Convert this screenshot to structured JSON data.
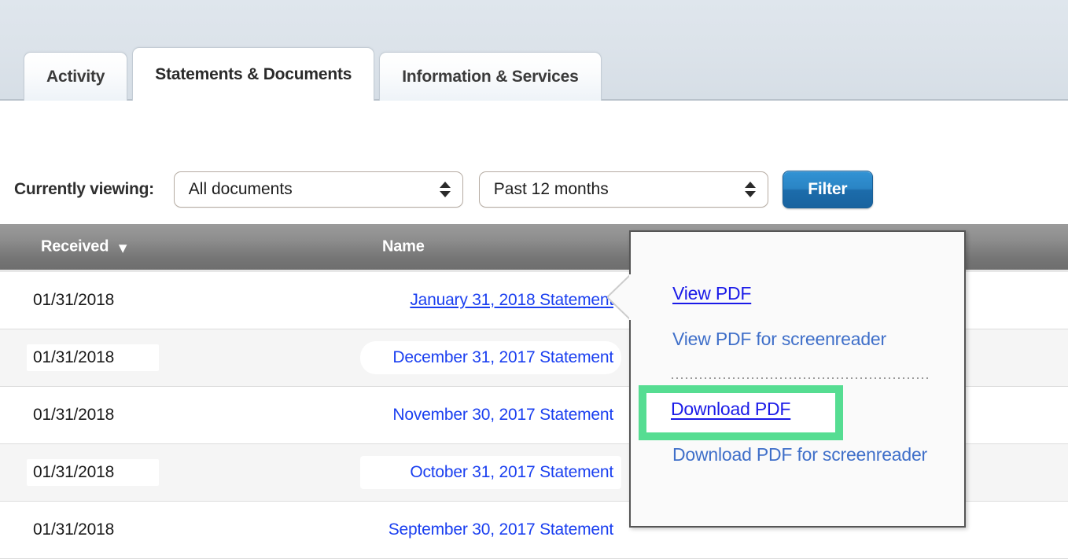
{
  "tabs": [
    {
      "label": "Activity",
      "active": false
    },
    {
      "label": "Statements & Documents",
      "active": true
    },
    {
      "label": "Information & Services",
      "active": false
    }
  ],
  "filter_bar": {
    "viewing_label": "Currently viewing:",
    "document_select": {
      "value": "All documents",
      "icon": "stepper-icon"
    },
    "period_select": {
      "value": "Past 12 months",
      "icon": "stepper-icon"
    },
    "filter_button": "Filter"
  },
  "table": {
    "columns": [
      {
        "key": "received",
        "label": "Received",
        "sort_icon": "▼",
        "sorted": true
      },
      {
        "key": "name",
        "label": "Name"
      }
    ],
    "rows": [
      {
        "received": "01/31/2018",
        "name": "January 31, 2018 Statement"
      },
      {
        "received": "01/31/2018",
        "name": "December 31, 2017 Statement"
      },
      {
        "received": "01/31/2018",
        "name": "November 30, 2017 Statement"
      },
      {
        "received": "01/31/2018",
        "name": "October 31, 2017 Statement"
      },
      {
        "received": "01/31/2018",
        "name": "September 30, 2017 Statement"
      }
    ]
  },
  "popup_menu": {
    "items": [
      {
        "label": "View PDF",
        "style": "strong"
      },
      {
        "label": "View PDF for screenreader",
        "style": "muted"
      },
      {
        "label": "Download PDF",
        "style": "strong",
        "highlighted": true
      },
      {
        "label": "Download PDF for screenreader",
        "style": "muted"
      }
    ]
  },
  "highlight": {
    "target_label": "Download PDF",
    "color": "#56dd92"
  },
  "colors": {
    "link": "#1a3ff0",
    "link_muted": "#3f6fc9",
    "filter_button": "#2a84c4",
    "table_header": "#8d8d8d",
    "highlight_green": "#56dd92",
    "topbar": "#dce3ea"
  }
}
